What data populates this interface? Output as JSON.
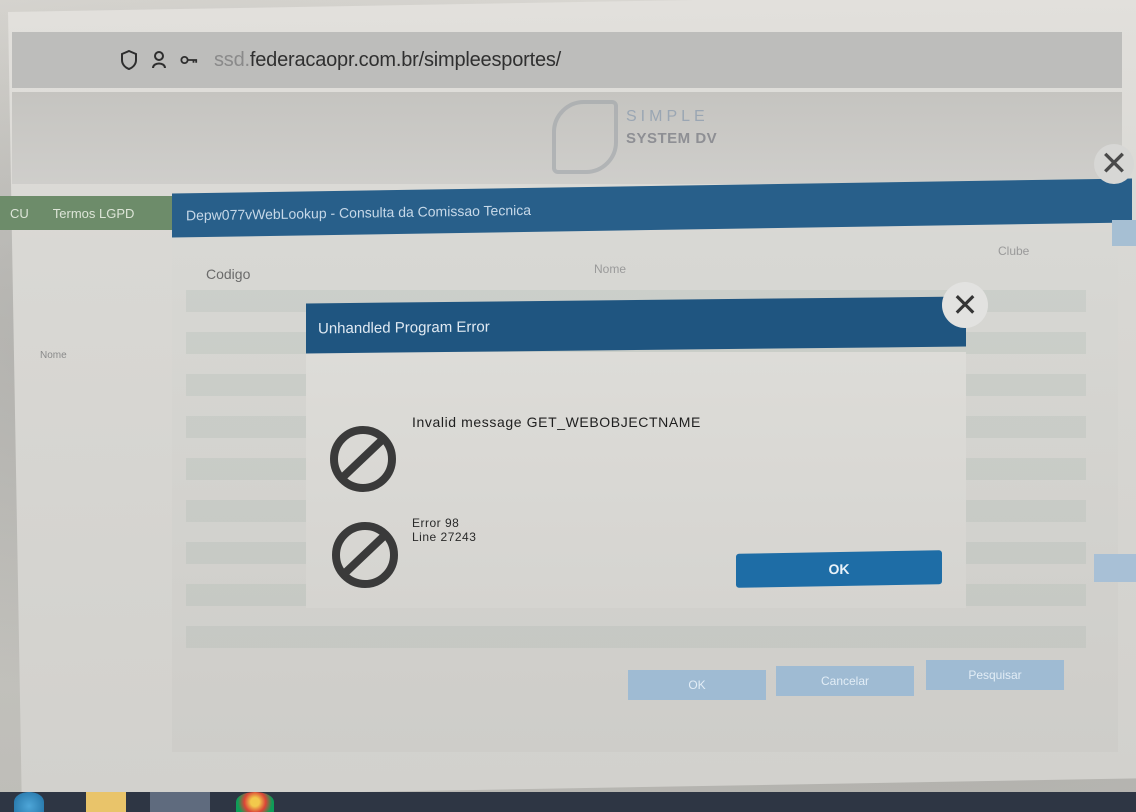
{
  "browser": {
    "url_prefix": "ssd.",
    "url_main": "federacaopr.com.br/simpleesportes/"
  },
  "logo": {
    "title": "SIMPLE",
    "subtitle": "SYSTEM DV"
  },
  "nav": {
    "items": [
      "CU",
      "Termos LGPD"
    ]
  },
  "lookup": {
    "title": "Depw077vWebLookup - Consulta da Comissao Tecnica",
    "columns": [
      "Codigo",
      "Nome",
      "Clube"
    ],
    "side_label": "Nome",
    "buttons": [
      "OK",
      "Cancelar",
      "Pesquisar"
    ]
  },
  "dialog": {
    "title": "Unhandled Program Error",
    "message": "Invalid message GET_WEBOBJECTNAME",
    "error_line1": "Error 98",
    "error_line2": "Line 27243",
    "ok_label": "OK"
  }
}
